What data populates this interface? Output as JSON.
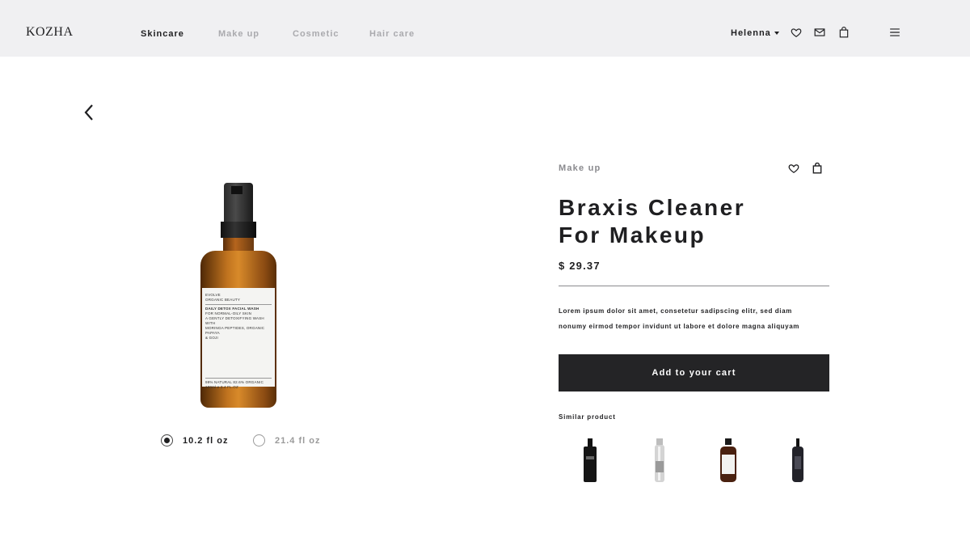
{
  "header": {
    "logo": "KOZHA",
    "nav": [
      {
        "label": "Skincare",
        "active": true
      },
      {
        "label": "Make up",
        "active": false
      },
      {
        "label": "Cosmetic",
        "active": false
      },
      {
        "label": "Hair care",
        "active": false
      }
    ],
    "user_name": "Helenna",
    "icons": [
      "heart-icon",
      "mail-icon",
      "bag-icon",
      "menu-icon"
    ]
  },
  "product": {
    "category": "Make up",
    "title_line1": "Braxis Cleaner",
    "title_line2": "For Makeup",
    "price": "$ 29.37",
    "description_line1": "Lorem ipsum dolor sit amet, consetetur sadipscing elitr, sed diam",
    "description_line2": "nonumy eirmod tempor invidunt ut labore et dolore magna aliquyam",
    "add_to_cart_label": "Add to your cart",
    "label_text": {
      "brand": "EVOLVE",
      "sub": "ORGANIC BEAUTY",
      "name": "DAILY DETOX FACIAL WASH",
      "l1": "FOR NORMAL-OILY SKIN",
      "l2": "A GENTLY DETOXIFYING WASH WITH",
      "l3": "MORINGA PEPTIDES, ORGANIC PAPAYA",
      "l4": "& GOJI",
      "f1": "99% NATURAL 82.6% ORGANIC",
      "f2": "100ml e 3.4 FL.OZ"
    }
  },
  "sizes": [
    {
      "label": "10.2 fl oz",
      "selected": true
    },
    {
      "label": "21.4 fl oz",
      "selected": false
    }
  ],
  "similar": {
    "title": "Similar product",
    "items": [
      {
        "icon": "black-bottle-icon",
        "color": "#1a1a1a"
      },
      {
        "icon": "silver-spray-icon",
        "color": "#c8c8c8"
      },
      {
        "icon": "amber-bottle-icon",
        "color": "#5a2a10"
      },
      {
        "icon": "dark-spray-icon",
        "color": "#2a2a30"
      }
    ]
  },
  "colors": {
    "header_bg": "#f0f0f2",
    "accent_dark": "#242426",
    "muted": "#aaaaae"
  }
}
